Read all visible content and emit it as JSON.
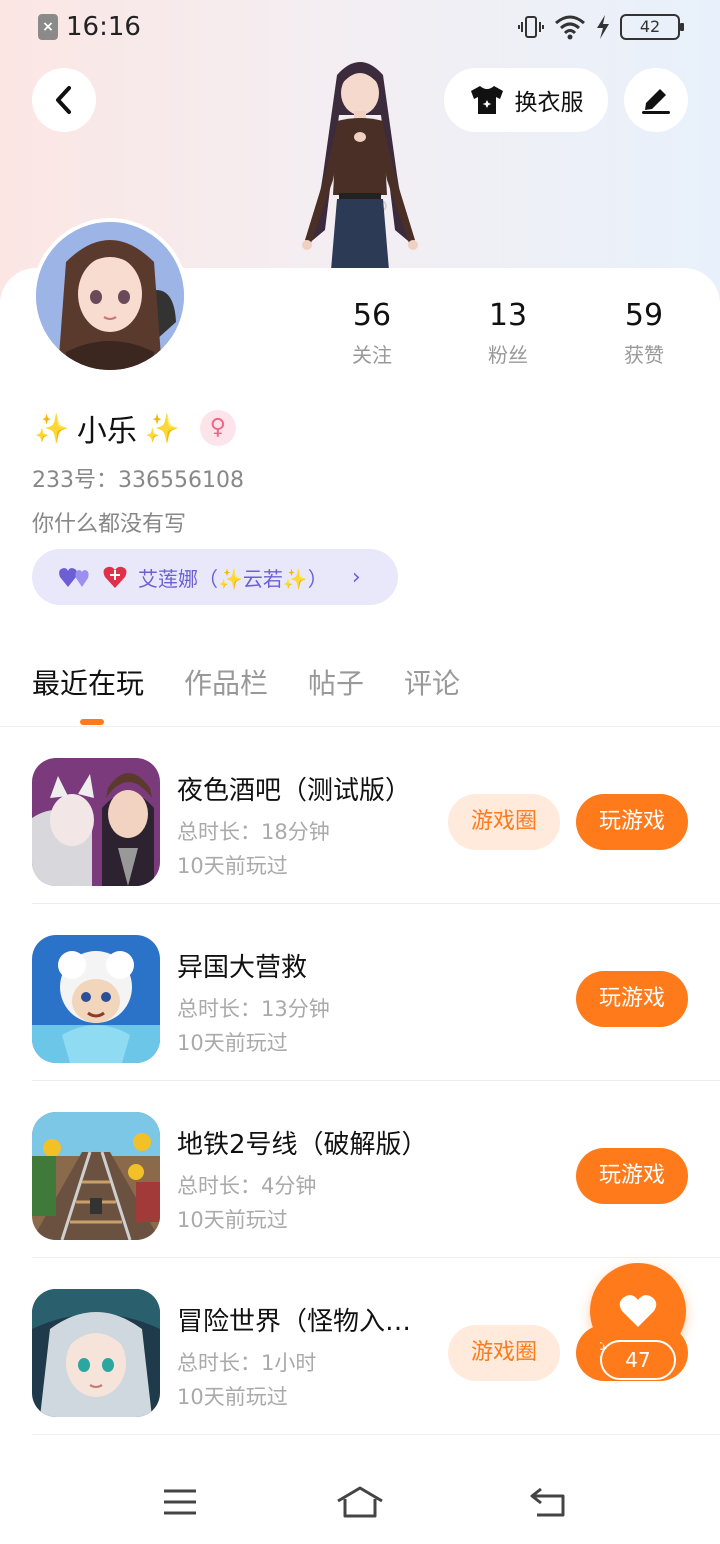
{
  "status_bar": {
    "time": "16:16",
    "battery": "42",
    "icons": [
      "sim-off-icon",
      "vibrate-icon",
      "wifi-icon",
      "charging-icon",
      "battery-icon"
    ]
  },
  "header": {
    "outfit_label": "换衣服",
    "back_icon": "back-arrow-icon",
    "edit_icon": "edit-pen-icon"
  },
  "stats": [
    {
      "value": "56",
      "label": "关注"
    },
    {
      "value": "13",
      "label": "粉丝"
    },
    {
      "value": "59",
      "label": "获赞"
    }
  ],
  "profile": {
    "sparkle_left": "✨",
    "name": "小乐",
    "sparkle_right": "✨",
    "gender_symbol": "♀",
    "account_id": "233号：336556108",
    "bio": "你什么都没有写",
    "relation": "艾莲娜（✨云若✨）"
  },
  "tabs": [
    "最近在玩",
    "作品栏",
    "帖子",
    "评论"
  ],
  "games": [
    {
      "title": "夜色酒吧（测试版）",
      "duration": "总时长：18分钟",
      "last_played": "10天前玩过",
      "circle_label": "游戏圈",
      "play_label": "玩游戏",
      "has_circle": true
    },
    {
      "title": "异国大营救",
      "duration": "总时长：13分钟",
      "last_played": "10天前玩过",
      "circle_label": "",
      "play_label": "玩游戏",
      "has_circle": false
    },
    {
      "title": "地铁2号线（破解版）",
      "duration": "总时长：4分钟",
      "last_played": "10天前玩过",
      "circle_label": "",
      "play_label": "玩游戏",
      "has_circle": false
    },
    {
      "title": "冒险世界（怪物入…",
      "duration": "总时长：1小时",
      "last_played": "10天前玩过",
      "circle_label": "游戏圈",
      "play_label": "玩游戏",
      "has_circle": true
    }
  ],
  "like_fab": {
    "count": "47",
    "icon": "heart-icon"
  },
  "nav": {
    "icons": [
      "menu-icon",
      "home-icon",
      "back-icon"
    ]
  },
  "colors": {
    "accent": "#ff7a1a",
    "accent_light": "#ffeadb",
    "relation_bg": "#e9e8fb",
    "relation_text": "#6c5fd6"
  }
}
